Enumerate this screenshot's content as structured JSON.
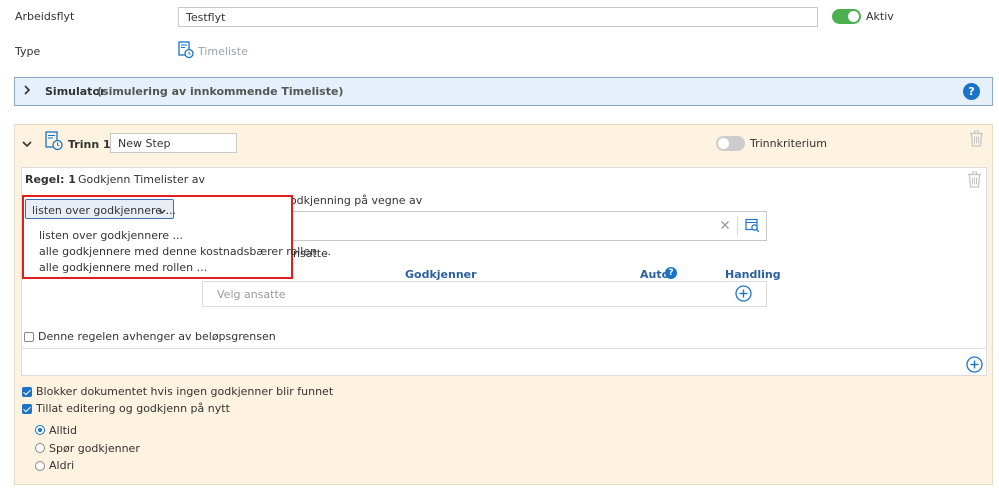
{
  "workflow": {
    "name_label": "Arbeidsflyt",
    "name_value": "Testflyt",
    "active_label": "Aktiv",
    "active_on": true,
    "type_label": "Type",
    "type_value": "Timeliste"
  },
  "simulator": {
    "title": "Simulator",
    "subtitle": "(simulering av innkommende Timeliste)",
    "help_icon": "?"
  },
  "step": {
    "label": "Trinn 1 :",
    "name_value": "New Step",
    "criteria_label": "Trinnkriterium",
    "criteria_on": false
  },
  "rule": {
    "label": "Regel: 1",
    "title": "Godkjenn Timelister av",
    "dropdown_selected": "listen over godkjennere ...",
    "dropdown_options": [
      "listen over godkjennere ...",
      "alle godkjennere med denne kostnadsbærer rollen ...",
      "alle godkjennere med rollen ..."
    ],
    "auto_approve_label": "Automatisk godkjenning på vegne av",
    "auto_approve_checked": false,
    "employees_label_partial": "nsatte",
    "table_headers": {
      "approver": "Godkjenner",
      "auto": "Auto",
      "action": "Handling"
    },
    "select_employees_placeholder": "Velg ansatte",
    "amount_limit_label": "Denne regelen avhenger av beløpsgrensen",
    "amount_limit_checked": false
  },
  "options": {
    "block_label": "Blokker dokumentet hvis ingen godkjenner blir funnet",
    "block_checked": true,
    "allow_edit_label": "Tillat editering og godkjenn på nytt",
    "allow_edit_checked": true,
    "radio_options": [
      "Alltid",
      "Spør godkjenner",
      "Aldri"
    ],
    "radio_selected": 0
  },
  "colors": {
    "accent": "#1a73c9",
    "toggle_on": "#4caf50",
    "toggle_off": "#cccccc",
    "simulator_bg": "#e6f0fa",
    "step_bg": "#fdf3e0",
    "highlight_red": "#e02020"
  },
  "icons": {
    "timesheet": "timesheet-icon",
    "chevron_right": "chevron-right-icon",
    "chevron_down": "chevron-down-icon",
    "trash": "trash-icon",
    "clear": "close-icon",
    "lookup": "lookup-icon",
    "add": "plus-circle-icon",
    "help": "help-icon"
  }
}
